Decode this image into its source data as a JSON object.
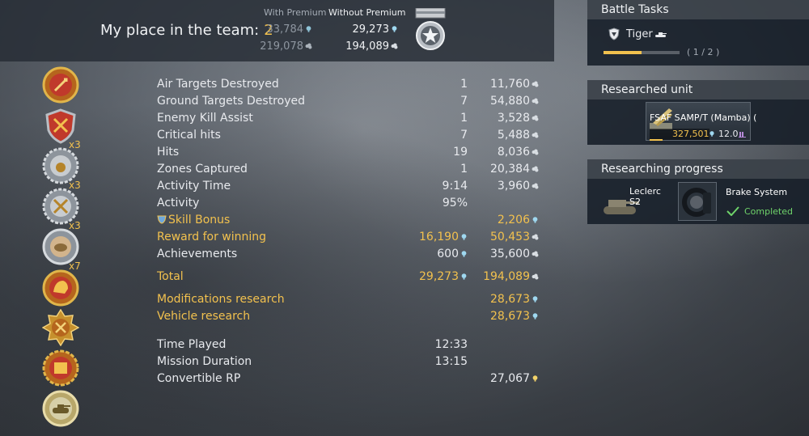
{
  "header": {
    "place_label": "My place in the team:",
    "place_value": "2",
    "col_premium": "With Premium",
    "col_no_premium": "Without Premium",
    "premium_sl": "33,784",
    "premium_rp": "219,078",
    "noprem_sl": "29,273",
    "noprem_rp": "194,089"
  },
  "stats": [
    {
      "label": "Air Targets Destroyed",
      "count": "1",
      "value": "11,760"
    },
    {
      "label": "Ground Targets Destroyed",
      "count": "7",
      "value": "54,880"
    },
    {
      "label": "Enemy Kill Assist",
      "count": "1",
      "value": "3,528"
    },
    {
      "label": "Critical hits",
      "count": "7",
      "value": "5,488"
    },
    {
      "label": "Hits",
      "count": "19",
      "value": "8,036"
    },
    {
      "label": "Zones Captured",
      "count": "1",
      "value": "20,384"
    },
    {
      "label": "Activity Time",
      "count": "9:14",
      "value": "3,960"
    },
    {
      "label": "Activity",
      "count": "95%",
      "value": ""
    },
    {
      "label": "Skill Bonus",
      "count": "",
      "value": "2,206"
    },
    {
      "label": "Reward for winning",
      "count": "16,190",
      "value": "50,453"
    },
    {
      "label": "Achievements",
      "count": "600",
      "value": "35,600"
    }
  ],
  "total": {
    "label": "Total",
    "sl": "29,273",
    "rp": "194,089"
  },
  "research": [
    {
      "label": "Modifications research",
      "value": "28,673"
    },
    {
      "label": "Vehicle research",
      "value": "28,673"
    }
  ],
  "timing": [
    {
      "label": "Time Played",
      "value": "12:33"
    },
    {
      "label": "Mission Duration",
      "value": "13:15"
    },
    {
      "label": "Convertible RP",
      "value": "27,067"
    }
  ],
  "award_multipliers": [
    "x3",
    "x3",
    "x3",
    "x7"
  ],
  "battle_tasks": {
    "title": "Battle Tasks",
    "task_name": "Tiger",
    "progress_text": "( 1 / 2 )",
    "progress": 0.5
  },
  "researched_unit": {
    "title": "Researched unit",
    "name": "FSAF SAMP/T (Mamba) (",
    "cost": "327,501",
    "br": "12.0"
  },
  "researching": {
    "title": "Researching progress",
    "vehicle": "Leclerc S2",
    "module": "Brake System",
    "status": "Completed"
  },
  "colors": {
    "gold": "#f2c14e",
    "green": "#6fd36a",
    "rp_blue": "#9fd8f0"
  }
}
